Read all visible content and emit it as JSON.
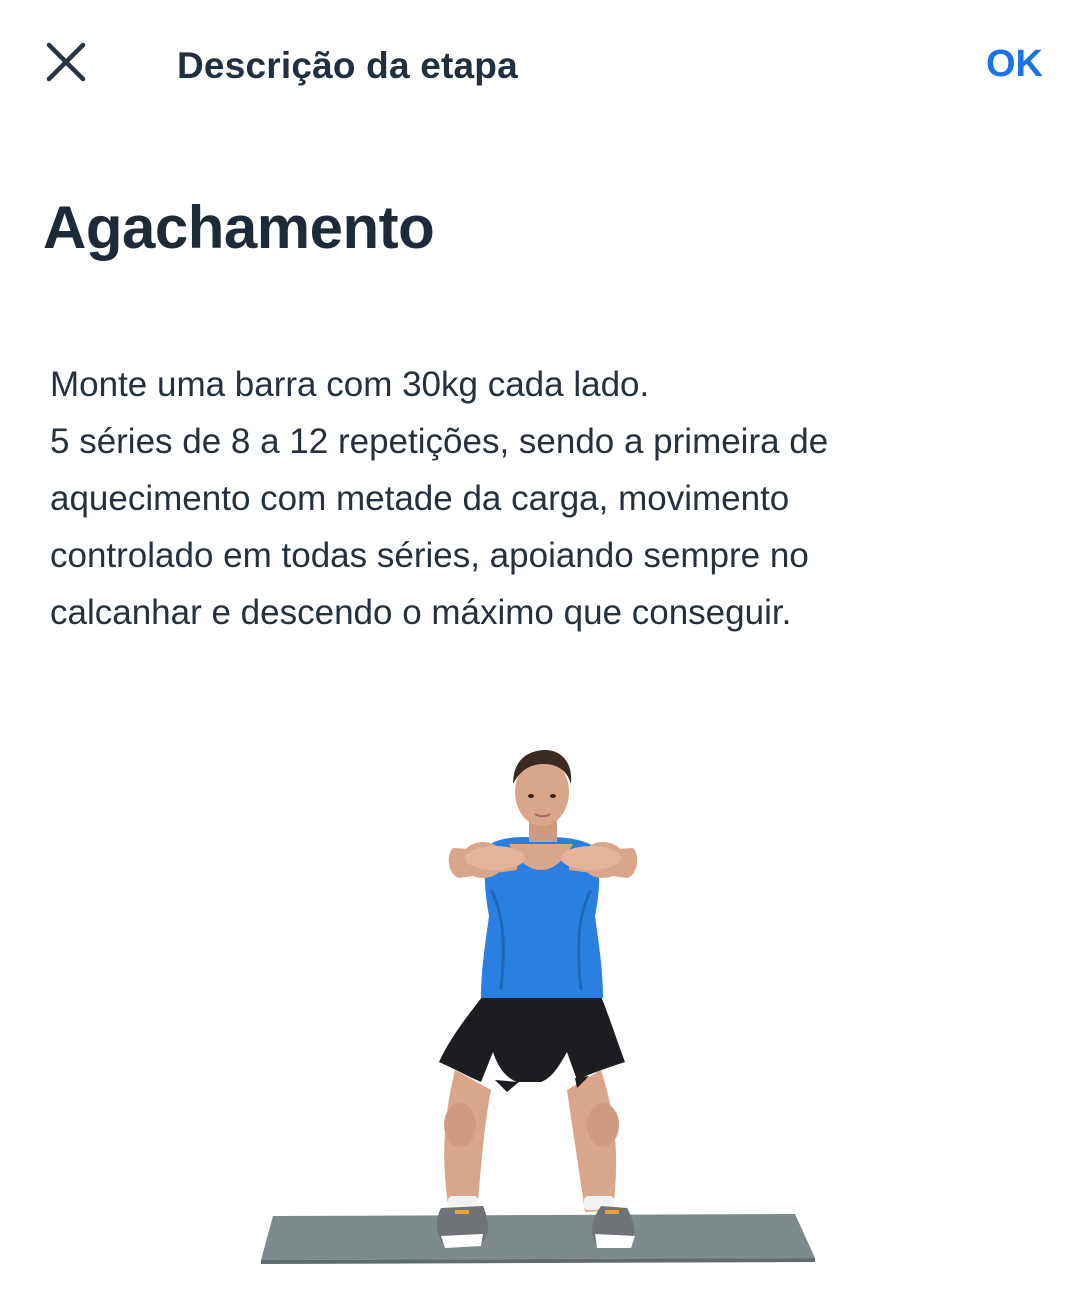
{
  "header": {
    "close_icon": "close-icon",
    "title": "Descrição da etapa",
    "ok_label": "OK"
  },
  "step": {
    "title": "Agachamento",
    "description_lines": [
      "Monte uma barra com 30kg cada lado.",
      "5 séries de 8 a 12 repetições, sendo a primeira de",
      "aquecimento com metade da carga, movimento",
      "controlado em todas séries, apoiando sempre no",
      "calcanhar e descendo o máximo que conseguir."
    ]
  },
  "colors": {
    "accent": "#1a73e8",
    "text": "#1e2a38",
    "shirt": "#2b7fe0",
    "mat": "#7e8a8c"
  }
}
